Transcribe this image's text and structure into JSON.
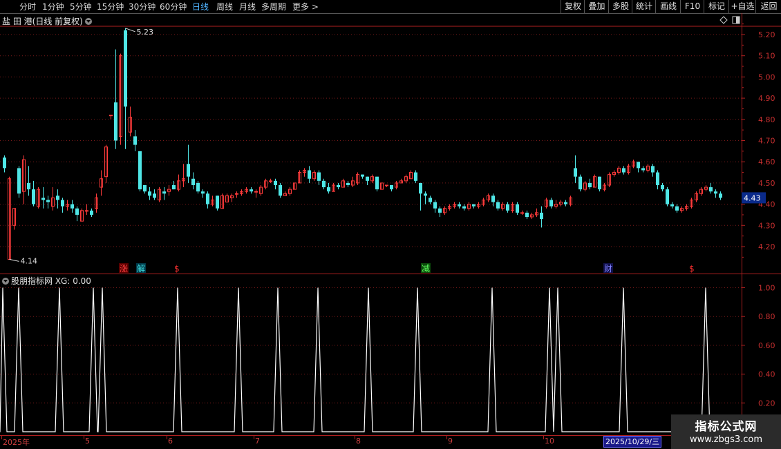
{
  "toolbar": {
    "periods": [
      "分时",
      "1分钟",
      "5分钟",
      "15分钟",
      "30分钟",
      "60分钟",
      "日线",
      "周线",
      "月线",
      "多周期",
      "更多"
    ],
    "active_period": "日线",
    "more_arrow": ">",
    "right_buttons": [
      "复权",
      "叠加",
      "多股",
      "统计",
      "画线",
      "F10",
      "标记",
      "+自选",
      "返回"
    ]
  },
  "stock": {
    "name": "盐 田 港",
    "mode": "(日线 前复权)"
  },
  "main_chart": {
    "high_label": "5.23",
    "low_label": "4.14",
    "current_price": "4.43",
    "axis_labels": [
      "5.20",
      "5.10",
      "5.00",
      "4.90",
      "4.80",
      "4.70",
      "4.60",
      "4.50",
      "4.40",
      "4.30",
      "4.20"
    ]
  },
  "markers": [
    {
      "text": "涨",
      "color": "#ff4040",
      "bg": "#5a0000"
    },
    {
      "text": "解",
      "color": "#40e0e0",
      "bg": "#003a4a"
    },
    {
      "text": "$",
      "color": "#ff3030",
      "bg": ""
    },
    {
      "text": "减",
      "color": "#60ff60",
      "bg": "#0a4a0a"
    },
    {
      "text": "财",
      "color": "#8080ff",
      "bg": "#10104a"
    },
    {
      "text": "$",
      "color": "#ff3030",
      "bg": ""
    }
  ],
  "indicator": {
    "title": "股朋指标网 XG: 0.00",
    "axis_labels": [
      "1.00",
      "0.80",
      "0.60",
      "0.40",
      "0.20"
    ]
  },
  "dates": {
    "labels": [
      "2025年",
      "5",
      "6",
      "7",
      "8",
      "9",
      "10"
    ],
    "current": "2025/10/29/三"
  },
  "watermark": {
    "line1": "指标公式网",
    "line2": "www.zbgs3.com"
  },
  "colors": {
    "up": "#ff3b3b",
    "down": "#4fe6e6",
    "grid": "#7a1a1a",
    "axis": "#b02020",
    "price_badge": "#0a2a8a"
  },
  "chart_data": {
    "type": "candlestick",
    "ylim": [
      4.14,
      5.23
    ],
    "candles": [
      [
        4.62,
        4.57,
        4.55,
        4.63
      ],
      [
        4.14,
        4.52,
        4.14,
        4.53
      ],
      [
        4.3,
        4.38,
        4.28,
        4.38
      ],
      [
        4.57,
        4.45,
        4.43,
        4.58
      ],
      [
        4.46,
        4.61,
        4.4,
        4.63
      ],
      [
        4.5,
        4.47,
        4.44,
        4.58
      ],
      [
        4.47,
        4.4,
        4.39,
        4.51
      ],
      [
        4.39,
        4.47,
        4.38,
        4.48
      ],
      [
        4.43,
        4.42,
        4.38,
        4.48
      ],
      [
        4.42,
        4.41,
        4.38,
        4.44
      ],
      [
        4.39,
        4.43,
        4.37,
        4.48
      ],
      [
        4.44,
        4.42,
        4.38,
        4.47
      ],
      [
        4.42,
        4.39,
        4.36,
        4.43
      ],
      [
        4.39,
        4.4,
        4.37,
        4.42
      ],
      [
        4.4,
        4.38,
        4.36,
        4.42
      ],
      [
        4.38,
        4.35,
        4.32,
        4.39
      ],
      [
        4.32,
        4.37,
        4.32,
        4.38
      ],
      [
        4.37,
        4.37,
        4.35,
        4.4
      ],
      [
        4.37,
        4.35,
        4.34,
        4.38
      ],
      [
        4.38,
        4.43,
        4.36,
        4.45
      ],
      [
        4.48,
        4.52,
        4.44,
        4.56
      ],
      [
        4.53,
        4.67,
        4.5,
        4.68
      ],
      [
        4.82,
        4.82,
        4.8,
        4.82
      ],
      [
        4.88,
        4.7,
        4.66,
        5.13
      ],
      [
        4.72,
        5.1,
        4.68,
        5.11
      ],
      [
        5.22,
        4.86,
        4.66,
        5.23
      ],
      [
        4.74,
        4.81,
        4.72,
        4.86
      ],
      [
        4.72,
        4.68,
        4.65,
        4.75
      ],
      [
        4.65,
        4.47,
        4.46,
        4.65
      ],
      [
        4.49,
        4.46,
        4.45,
        4.49
      ],
      [
        4.46,
        4.44,
        4.42,
        4.48
      ],
      [
        4.45,
        4.43,
        4.42,
        4.47
      ],
      [
        4.42,
        4.47,
        4.41,
        4.48
      ],
      [
        4.46,
        4.45,
        4.42,
        4.48
      ],
      [
        4.46,
        4.47,
        4.44,
        4.49
      ],
      [
        4.49,
        4.47,
        4.47,
        4.51
      ],
      [
        4.47,
        4.51,
        4.46,
        4.54
      ],
      [
        4.51,
        4.52,
        4.48,
        4.59
      ],
      [
        4.59,
        4.53,
        4.5,
        4.68
      ],
      [
        4.52,
        4.49,
        4.47,
        4.55
      ],
      [
        4.5,
        4.46,
        4.45,
        4.51
      ],
      [
        4.46,
        4.45,
        4.43,
        4.47
      ],
      [
        4.45,
        4.4,
        4.38,
        4.46
      ],
      [
        4.4,
        4.42,
        4.39,
        4.44
      ],
      [
        4.44,
        4.38,
        4.37,
        4.44
      ],
      [
        4.38,
        4.44,
        4.38,
        4.45
      ],
      [
        4.41,
        4.44,
        4.41,
        4.45
      ],
      [
        4.43,
        4.44,
        4.41,
        4.45
      ],
      [
        4.45,
        4.45,
        4.43,
        4.46
      ],
      [
        4.45,
        4.46,
        4.44,
        4.47
      ],
      [
        4.46,
        4.47,
        4.45,
        4.48
      ],
      [
        4.47,
        4.46,
        4.45,
        4.48
      ],
      [
        4.46,
        4.46,
        4.43,
        4.47
      ],
      [
        4.45,
        4.48,
        4.44,
        4.49
      ],
      [
        4.48,
        4.51,
        4.47,
        4.52
      ],
      [
        4.51,
        4.51,
        4.5,
        4.52
      ],
      [
        4.51,
        4.49,
        4.47,
        4.52
      ],
      [
        4.49,
        4.44,
        4.43,
        4.5
      ],
      [
        4.44,
        4.45,
        4.44,
        4.46
      ],
      [
        4.45,
        4.47,
        4.44,
        4.48
      ],
      [
        4.47,
        4.5,
        4.47,
        4.5
      ],
      [
        4.5,
        4.55,
        4.5,
        4.56
      ],
      [
        4.55,
        4.56,
        4.53,
        4.57
      ],
      [
        4.56,
        4.52,
        4.5,
        4.58
      ],
      [
        4.52,
        4.55,
        4.51,
        4.56
      ],
      [
        4.55,
        4.51,
        4.49,
        4.56
      ],
      [
        4.51,
        4.48,
        4.47,
        4.52
      ],
      [
        4.48,
        4.46,
        4.45,
        4.5
      ],
      [
        4.46,
        4.49,
        4.46,
        4.5
      ],
      [
        4.49,
        4.48,
        4.47,
        4.5
      ],
      [
        4.48,
        4.51,
        4.48,
        4.52
      ],
      [
        4.5,
        4.49,
        4.48,
        4.51
      ],
      [
        4.49,
        4.51,
        4.48,
        4.53
      ],
      [
        4.5,
        4.54,
        4.49,
        4.55
      ],
      [
        4.54,
        4.53,
        4.52,
        4.54
      ],
      [
        4.53,
        4.51,
        4.49,
        4.53
      ],
      [
        4.51,
        4.53,
        4.5,
        4.54
      ],
      [
        4.53,
        4.47,
        4.46,
        4.53
      ],
      [
        4.47,
        4.5,
        4.47,
        4.5
      ],
      [
        4.49,
        4.49,
        4.48,
        4.49
      ],
      [
        4.49,
        4.47,
        4.46,
        4.49
      ],
      [
        4.48,
        4.5,
        4.47,
        4.51
      ],
      [
        4.5,
        4.51,
        4.5,
        4.52
      ],
      [
        4.51,
        4.53,
        4.5,
        4.54
      ],
      [
        4.52,
        4.55,
        4.52,
        4.56
      ],
      [
        4.55,
        4.51,
        4.5,
        4.56
      ],
      [
        4.5,
        4.45,
        4.37,
        4.5
      ],
      [
        4.45,
        4.44,
        4.4,
        4.46
      ],
      [
        4.43,
        4.41,
        4.4,
        4.44
      ],
      [
        4.41,
        4.38,
        4.36,
        4.42
      ],
      [
        4.38,
        4.36,
        4.34,
        4.39
      ],
      [
        4.36,
        4.38,
        4.35,
        4.39
      ],
      [
        4.38,
        4.39,
        4.37,
        4.4
      ],
      [
        4.39,
        4.4,
        4.38,
        4.41
      ],
      [
        4.4,
        4.39,
        4.38,
        4.41
      ],
      [
        4.39,
        4.38,
        4.37,
        4.4
      ],
      [
        4.38,
        4.4,
        4.37,
        4.41
      ],
      [
        4.4,
        4.39,
        4.38,
        4.4
      ],
      [
        4.39,
        4.4,
        4.38,
        4.41
      ],
      [
        4.4,
        4.42,
        4.39,
        4.43
      ],
      [
        4.42,
        4.44,
        4.41,
        4.45
      ],
      [
        4.44,
        4.41,
        4.39,
        4.45
      ],
      [
        4.41,
        4.38,
        4.37,
        4.42
      ],
      [
        4.38,
        4.4,
        4.37,
        4.41
      ],
      [
        4.4,
        4.37,
        4.36,
        4.41
      ],
      [
        4.37,
        4.4,
        4.36,
        4.41
      ],
      [
        4.4,
        4.36,
        4.35,
        4.41
      ],
      [
        4.36,
        4.36,
        4.35,
        4.37
      ],
      [
        4.36,
        4.34,
        4.33,
        4.37
      ],
      [
        4.34,
        4.35,
        4.33,
        4.36
      ],
      [
        4.35,
        4.36,
        4.34,
        4.38
      ],
      [
        4.36,
        4.33,
        4.29,
        4.39
      ],
      [
        4.39,
        4.42,
        4.38,
        4.43
      ],
      [
        4.42,
        4.39,
        4.38,
        4.43
      ],
      [
        4.39,
        4.4,
        4.38,
        4.42
      ],
      [
        4.4,
        4.41,
        4.39,
        4.42
      ],
      [
        4.41,
        4.4,
        4.39,
        4.42
      ],
      [
        4.4,
        4.43,
        4.39,
        4.44
      ],
      [
        4.57,
        4.53,
        4.5,
        4.63
      ],
      [
        4.53,
        4.47,
        4.46,
        4.54
      ],
      [
        4.47,
        4.5,
        4.46,
        4.51
      ],
      [
        4.5,
        4.48,
        4.47,
        4.52
      ],
      [
        4.48,
        4.53,
        4.48,
        4.54
      ],
      [
        4.53,
        4.47,
        4.46,
        4.53
      ],
      [
        4.47,
        4.49,
        4.46,
        4.5
      ],
      [
        4.49,
        4.54,
        4.48,
        4.55
      ],
      [
        4.54,
        4.55,
        4.53,
        4.56
      ],
      [
        4.55,
        4.57,
        4.54,
        4.58
      ],
      [
        4.57,
        4.55,
        4.54,
        4.58
      ],
      [
        4.55,
        4.58,
        4.54,
        4.59
      ],
      [
        4.58,
        4.6,
        4.57,
        4.61
      ],
      [
        4.6,
        4.57,
        4.55,
        4.6
      ],
      [
        4.57,
        4.56,
        4.55,
        4.58
      ],
      [
        4.56,
        4.58,
        4.55,
        4.59
      ],
      [
        4.58,
        4.55,
        4.53,
        4.59
      ],
      [
        4.55,
        4.49,
        4.47,
        4.56
      ],
      [
        4.49,
        4.47,
        4.46,
        4.5
      ],
      [
        4.47,
        4.4,
        4.39,
        4.48
      ],
      [
        4.4,
        4.39,
        4.38,
        4.41
      ],
      [
        4.39,
        4.37,
        4.36,
        4.4
      ],
      [
        4.37,
        4.38,
        4.36,
        4.39
      ],
      [
        4.38,
        4.39,
        4.37,
        4.4
      ],
      [
        4.39,
        4.42,
        4.38,
        4.43
      ],
      [
        4.42,
        4.45,
        4.41,
        4.46
      ],
      [
        4.45,
        4.47,
        4.44,
        4.48
      ],
      [
        4.47,
        4.48,
        4.46,
        4.49
      ],
      [
        4.48,
        4.46,
        4.45,
        4.5
      ],
      [
        4.46,
        4.45,
        4.43,
        4.47
      ],
      [
        4.45,
        4.43,
        4.42,
        4.46
      ]
    ]
  }
}
